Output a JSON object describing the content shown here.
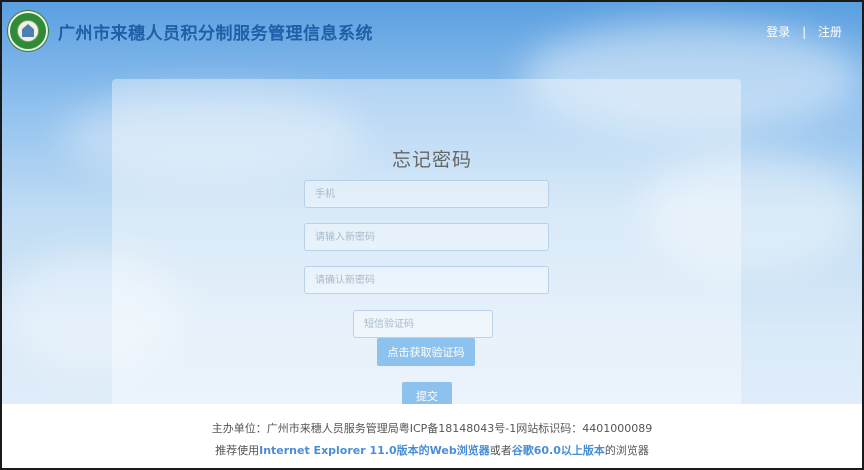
{
  "header": {
    "site_title": "广州市来穗人员积分制服务管理信息系统",
    "login_label": "登录",
    "separator": "|",
    "register_label": "注册"
  },
  "form": {
    "title": "忘记密码",
    "phone_placeholder": "手机",
    "new_password_placeholder": "请输入新密码",
    "confirm_password_placeholder": "请确认新密码",
    "sms_code_placeholder": "短信验证码",
    "get_code_label": "点击获取验证码",
    "submit_label": "提交"
  },
  "footer": {
    "line1": "主办单位：广州市来穗人员服务管理局粤ICP备18148043号-1网站标识码：4401000089",
    "line2_prefix": "推荐使用",
    "line2_ie": "Internet Explorer 11.0版本的Web浏览器",
    "line2_mid": "或者",
    "line2_chrome": "谷歌60.0以上版本",
    "line2_suffix": "的浏览器"
  },
  "colors": {
    "title_blue": "#1f5fa8",
    "button_blue": "#8ec2ee",
    "link_blue": "#4a8ed6"
  }
}
